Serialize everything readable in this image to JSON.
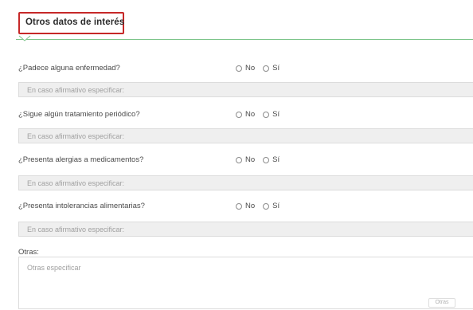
{
  "section": {
    "title": "Otros datos de interés"
  },
  "questions": [
    {
      "label": "¿Padece alguna enfermedad?",
      "option_no": "No",
      "option_yes": "Sí",
      "placeholder": "En caso afirmativo especificar:"
    },
    {
      "label": "¿Sigue algún tratamiento periódico?",
      "option_no": "No",
      "option_yes": "Sí",
      "placeholder": "En caso afirmativo especificar:"
    },
    {
      "label": "¿Presenta alergias a medicamentos?",
      "option_no": "No",
      "option_yes": "Sí",
      "placeholder": "En caso afirmativo especificar:"
    },
    {
      "label": "¿Presenta intolerancias alimentarias?",
      "option_no": "No",
      "option_yes": "Sí",
      "placeholder": "En caso afirmativo especificar:"
    }
  ],
  "otras": {
    "label": "Otras:",
    "placeholder": "Otras especificar",
    "badge": "Otras"
  },
  "colors": {
    "title_border": "#c62828",
    "header_line": "#7cc48a"
  }
}
